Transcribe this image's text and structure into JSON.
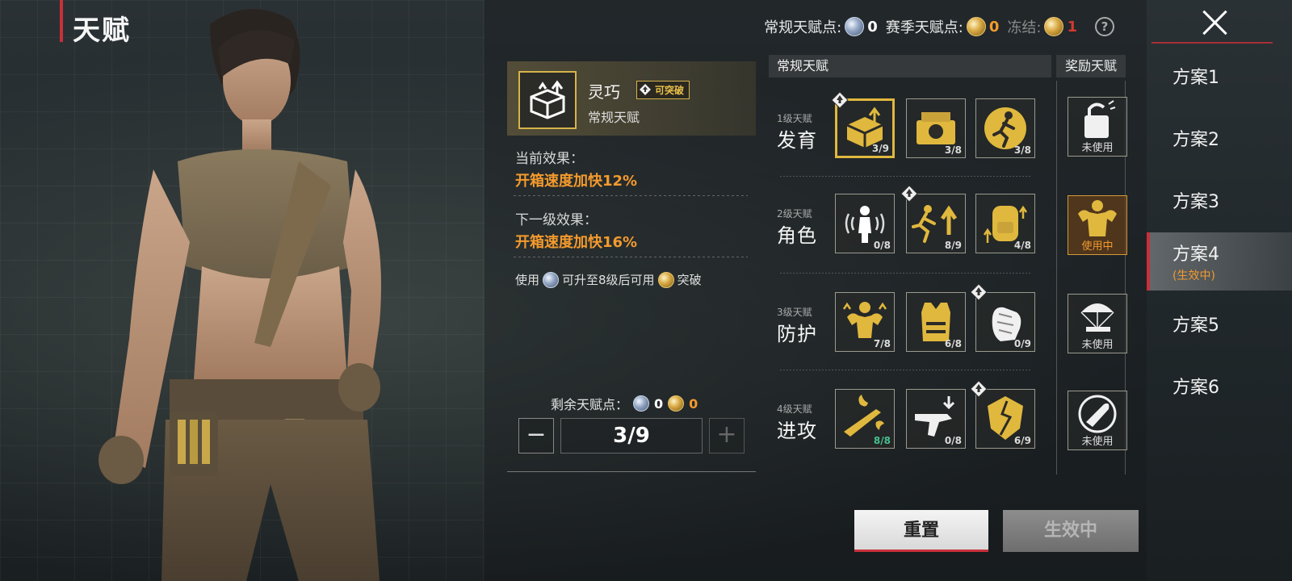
{
  "header": {
    "title": "天赋"
  },
  "points": {
    "regular_label": "常规天赋点:",
    "regular_value": "0",
    "season_label": "赛季天赋点:",
    "season_value": "0",
    "frozen_label": "冻结:",
    "frozen_value": "1",
    "help": "?"
  },
  "plans": [
    {
      "label": "方案1"
    },
    {
      "label": "方案2"
    },
    {
      "label": "方案3"
    },
    {
      "label": "方案4",
      "status": "(生效中)"
    },
    {
      "label": "方案5"
    },
    {
      "label": "方案6"
    }
  ],
  "detail": {
    "name": "灵巧",
    "badge": "可突破",
    "type": "常规天赋",
    "current_label": "当前效果：",
    "current_value": "开箱速度加快12%",
    "next_label": "下一级效果：",
    "next_value": "开箱速度加快16%",
    "use_prefix": "使用",
    "use_middle": "可升至8级后可用",
    "use_suffix": "突破",
    "remain_label": "剩余天赋点：",
    "remain_silver": "0",
    "remain_gold": "0",
    "minus": "−",
    "plus": "+",
    "level": "3/9"
  },
  "tree": {
    "header": "常规天赋",
    "bonus_header": "奖励天赋",
    "tiers": [
      {
        "level": "1级天赋",
        "name": "发育",
        "talents": [
          {
            "icon": "supply-crate-upgrade-icon",
            "count": "3/9",
            "selected": true,
            "breakthrough": true
          },
          {
            "icon": "medkit-crate-icon",
            "count": "3/8"
          },
          {
            "icon": "runner-circle-icon",
            "count": "3/8"
          }
        ],
        "bonus": {
          "icon": "broken-lock-icon",
          "label": "未使用"
        }
      },
      {
        "level": "2级天赋",
        "name": "角色",
        "talents": [
          {
            "icon": "soldier-sound-icon",
            "count": "0/8"
          },
          {
            "icon": "sprint-up-icon",
            "count": "8/9",
            "breakthrough": true
          },
          {
            "icon": "backpack-up-icon",
            "count": "4/8"
          }
        ],
        "bonus": {
          "icon": "strongman-icon",
          "label": "使用中",
          "active": true
        }
      },
      {
        "level": "3级天赋",
        "name": "防护",
        "talents": [
          {
            "icon": "muscle-up-icon",
            "count": "7/8"
          },
          {
            "icon": "body-armor-icon",
            "count": "6/8"
          },
          {
            "icon": "glove-hand-icon",
            "count": "0/9",
            "breakthrough": true
          }
        ],
        "bonus": {
          "icon": "parachute-gun-icon",
          "label": "未使用"
        }
      },
      {
        "level": "4级天赋",
        "name": "进攻",
        "talents": [
          {
            "icon": "fire-rifle-icon",
            "count": "8/8",
            "full": true
          },
          {
            "icon": "rifle-down-icon",
            "count": "0/8"
          },
          {
            "icon": "shield-crack-icon",
            "count": "6/9",
            "breakthrough": true
          }
        ],
        "bonus": {
          "icon": "bullet-circle-icon",
          "label": "未使用"
        }
      }
    ]
  },
  "actions": {
    "reset": "重置",
    "active": "生效中"
  },
  "colors": {
    "accent_red": "#c8303a",
    "orange": "#f39a2d",
    "gold": "#e0b83e",
    "green": "#46c08f"
  }
}
